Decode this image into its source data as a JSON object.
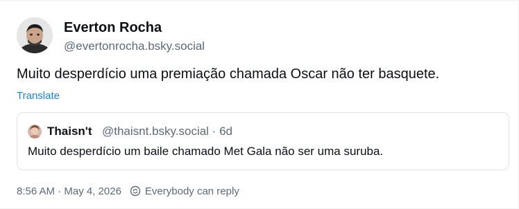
{
  "post": {
    "author": {
      "display_name": "Everton Rocha",
      "handle": "@evertonrocha.bsky.social"
    },
    "text": "Muito desperdício uma premiação chamada Oscar não ter basquete.",
    "translate_label": "Translate",
    "quote": {
      "author_name": "Thaisn't",
      "handle": "@thaisnt.bsky.social",
      "age": "6d",
      "text": "Muito desperdício um baile chamado Met Gala não ser uma suruba."
    },
    "footer": {
      "timestamp": "8:56 AM · May 4, 2026",
      "reply_setting": "Everybody can reply"
    }
  },
  "colors": {
    "link": "#1083fe",
    "muted_text": "#5b6a78",
    "primary_text": "#0b0f14",
    "border": "#dfe3e8"
  },
  "icons": [
    "avatar",
    "quote-avatar",
    "reply-settings-icon"
  ]
}
